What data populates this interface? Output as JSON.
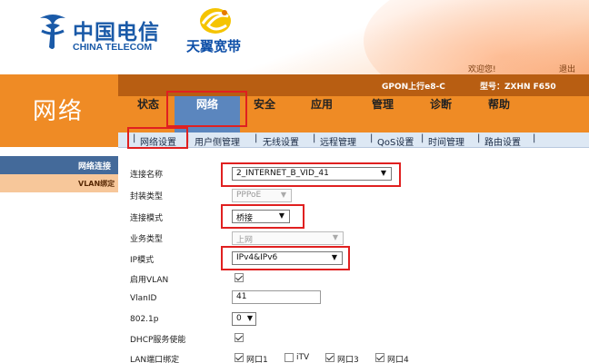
{
  "header": {
    "brand_cn": "中国电信",
    "brand_en": "CHINA TELECOM",
    "brand2": "天翼宽带",
    "welcome": "欢迎您!",
    "logout": "退出"
  },
  "info_bar": {
    "gpon": "GPON上行e8-C",
    "model": "型号：ZXHN F650"
  },
  "page_title": "网络",
  "tabs": [
    {
      "label": "状态"
    },
    {
      "label": "网络",
      "active": true
    },
    {
      "label": "安全"
    },
    {
      "label": "应用"
    },
    {
      "label": "管理"
    },
    {
      "label": "诊断"
    },
    {
      "label": "帮助"
    }
  ],
  "subtabs": [
    {
      "label": "网络设置",
      "active": true
    },
    {
      "label": "用户侧管理"
    },
    {
      "label": "无线设置"
    },
    {
      "label": "远程管理"
    },
    {
      "label": "QoS设置"
    },
    {
      "label": "时间管理"
    },
    {
      "label": "路由设置"
    }
  ],
  "sidebar": {
    "items": [
      {
        "label": "网络连接",
        "active": true
      },
      {
        "label": "VLAN绑定"
      }
    ]
  },
  "form": {
    "connection_name": {
      "label": "连接名称",
      "value": "2_INTERNET_B_VID_41"
    },
    "encap_type": {
      "label": "封装类型",
      "value": "PPPoE",
      "disabled": true
    },
    "conn_mode": {
      "label": "连接模式",
      "value": "桥接"
    },
    "service_type": {
      "label": "业务类型",
      "value": "上网",
      "disabled": true
    },
    "ip_mode": {
      "label": "IP模式",
      "value": "IPv4&IPv6"
    },
    "enable_vlan": {
      "label": "启用VLAN",
      "checked": true
    },
    "vlan_id": {
      "label": "VlanID",
      "value": "41"
    },
    "dot1p": {
      "label": "802.1p",
      "value": "0"
    },
    "dhcp_enable": {
      "label": "DHCP服务使能",
      "checked": true
    },
    "lan_bind": {
      "label": "LAN端口绑定",
      "ports": [
        {
          "label": "网口1",
          "checked": true
        },
        {
          "label": "iTV",
          "checked": false
        },
        {
          "label": "网口3",
          "checked": true
        },
        {
          "label": "网口4",
          "checked": true
        }
      ]
    }
  },
  "colors": {
    "orange": "#ef8b25",
    "dark_orange": "#b85e12",
    "blue_tab": "#5b86be",
    "highlight": "#e02020"
  }
}
